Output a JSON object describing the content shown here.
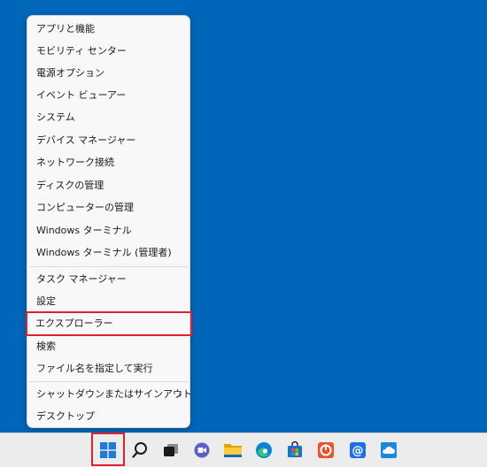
{
  "context_menu": {
    "items": [
      {
        "label": "アプリと機能"
      },
      {
        "label": "モビリティ センター"
      },
      {
        "label": "電源オプション"
      },
      {
        "label": "イベント ビューアー"
      },
      {
        "label": "システム"
      },
      {
        "label": "デバイス マネージャー"
      },
      {
        "label": "ネットワーク接続"
      },
      {
        "label": "ディスクの管理"
      },
      {
        "label": "コンピューターの管理"
      },
      {
        "label": "Windows ターミナル"
      },
      {
        "label": "Windows ターミナル (管理者)"
      },
      {
        "label": "タスク マネージャー"
      },
      {
        "label": "設定"
      },
      {
        "label": "エクスプローラー"
      },
      {
        "label": "検索"
      },
      {
        "label": "ファイル名を指定して実行"
      },
      {
        "label": "シャットダウンまたはサインアウト",
        "submenu_indicator": "›"
      },
      {
        "label": "デスクトップ"
      }
    ],
    "highlighted_item": "エクスプローラー"
  },
  "taskbar": {
    "icons": [
      "windows-start-icon",
      "search-icon",
      "task-view-icon",
      "chat-icon",
      "file-explorer-icon",
      "edge-browser-icon",
      "microsoft-store-icon",
      "app-icon-orange",
      "mail-icon",
      "weather-cloud-icon"
    ],
    "highlighted_icon": "windows-start-icon"
  },
  "colors": {
    "desktop": "#0066b9",
    "highlight_border": "#e0202c"
  }
}
